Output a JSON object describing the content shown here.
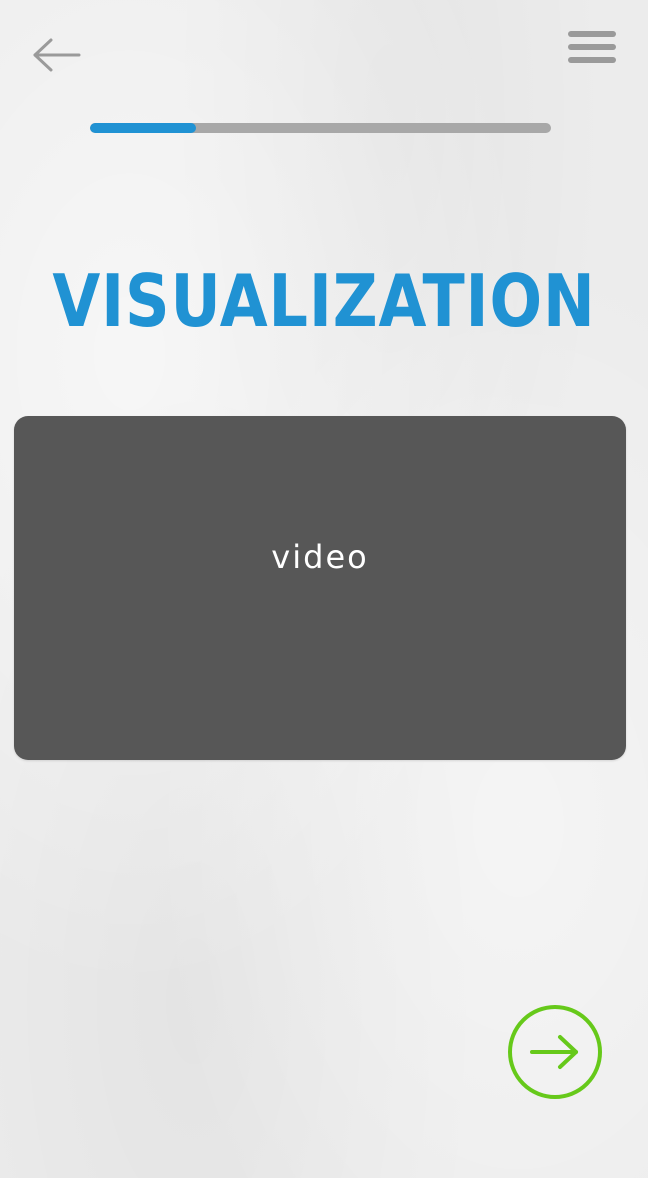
{
  "header": {
    "back_icon": "arrow-left-icon",
    "menu_icon": "hamburger-menu-icon"
  },
  "progress": {
    "fraction": 0.23,
    "fill_color": "#2092d3",
    "track_color": "#a8a8a8"
  },
  "title": "VISUALIZATION",
  "video": {
    "label": "video"
  },
  "footer": {
    "next_icon": "arrow-right-icon",
    "next_color": "#66c91a"
  },
  "colors": {
    "accent": "#2092d3",
    "video_background": "#575757"
  }
}
